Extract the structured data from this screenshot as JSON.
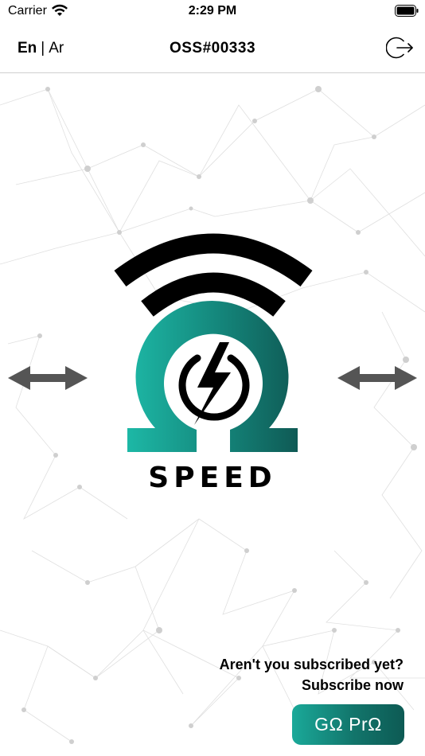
{
  "status_bar": {
    "carrier": "Carrier",
    "time": "2:29 PM"
  },
  "nav": {
    "lang_en": "En",
    "lang_sep": "|",
    "lang_ar": "Ar",
    "title": "OSS#00333",
    "logout_icon": "logout-icon"
  },
  "logo": {
    "text": "SPEED",
    "icon": "omega-lightning-wifi-logo"
  },
  "subscribe": {
    "question": "Aren't you subscribed yet?",
    "cta": "Subscribe now",
    "button_label": "GΩ PrΩ"
  },
  "colors": {
    "brand_teal": "#1aa999",
    "brand_dark_teal": "#0d5a54",
    "text": "#000000",
    "arrow": "#555555"
  }
}
